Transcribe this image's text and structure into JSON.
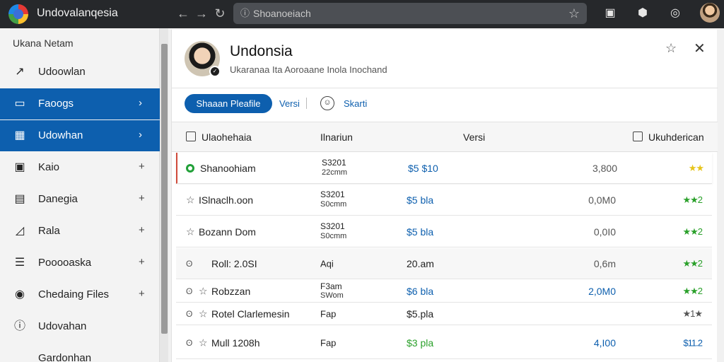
{
  "app": {
    "title": "Undovalanqesia"
  },
  "browser": {
    "back_icon": "arrow-left-icon",
    "forward_icon": "arrow-right-icon",
    "reload_icon": "reload-icon",
    "address_text": "Shoanoeiach",
    "address_icon": "info-icon",
    "bookmark_icon": "star-outline-icon",
    "toolbar_icons": [
      "save-icon",
      "extension-icon",
      "account-circle-icon"
    ]
  },
  "sidebar": {
    "header": "Ukana Netam",
    "items": [
      {
        "label": "Udoowlan",
        "icon": "edit-icon",
        "glyph": "↗",
        "active": false,
        "chevron": ""
      },
      {
        "label": "Faoogs",
        "icon": "folder-icon",
        "glyph": "▭",
        "active": true,
        "chevron": "›"
      },
      {
        "label": "Udowhan",
        "icon": "building-icon",
        "glyph": "▦",
        "active": true,
        "chevron": "›"
      },
      {
        "label": "Kaio",
        "icon": "calendar-icon",
        "glyph": "▣",
        "active": false,
        "chevron": "+"
      },
      {
        "label": "Danegia",
        "icon": "document-icon",
        "glyph": "▤",
        "active": false,
        "chevron": "+"
      },
      {
        "label": "Rala",
        "icon": "chart-icon",
        "glyph": "◿",
        "active": false,
        "chevron": "+"
      },
      {
        "label": "Pooooaska",
        "icon": "list-icon",
        "glyph": "☰",
        "active": false,
        "chevron": "+"
      },
      {
        "label": "Chedaing Files",
        "icon": "record-icon",
        "glyph": "◉",
        "active": false,
        "chevron": "+"
      },
      {
        "label": "Udovahan",
        "icon": "clock-icon",
        "glyph": "ⓘ",
        "active": false,
        "chevron": ""
      },
      {
        "label": "Gardonhan",
        "icon": "",
        "glyph": "",
        "active": false,
        "chevron": ""
      }
    ]
  },
  "main": {
    "title": "Undonsia",
    "subtitle": "Ukaranaa Ita Aoroaane Inola Inochand",
    "primary_button": "Shaaan Pleafile",
    "link_versi": "Versi",
    "link_skarti": "Skarti",
    "table": {
      "columns": [
        "Ulaohehaia",
        "Ilnariun",
        "Versi",
        "Ukuhderican"
      ],
      "rows": [
        {
          "lead": "",
          "mark": "dot",
          "name": "Shanoohiam",
          "a1": "S3201",
          "a2": "22cmm",
          "price": "$5 $10",
          "price_color": "#0d5fae",
          "version": "3,800",
          "version_color": "#555",
          "rating": "★★",
          "rating_color": "#e6c41a",
          "selected": true,
          "alt": false
        },
        {
          "lead": "",
          "mark": "star",
          "name": "ISlnaclh.oon",
          "a1": "S3201",
          "a2": "S0cmm",
          "price": "$5 bla",
          "price_color": "#0d5fae",
          "version": "0,0M0",
          "version_color": "#555",
          "rating": "★★2",
          "rating_color": "#2aa02a",
          "selected": false,
          "alt": false
        },
        {
          "lead": "",
          "mark": "star",
          "name": "Bozann Dom",
          "a1": "S3201",
          "a2": "S0cmm",
          "price": "$5 bla",
          "price_color": "#0d5fae",
          "version": "0,0I0",
          "version_color": "#555",
          "rating": "★★2",
          "rating_color": "#2aa02a",
          "selected": false,
          "alt": false
        },
        {
          "lead": "ʘ",
          "mark": "",
          "name": "Roll: 2.0SI",
          "a1": "",
          "a2": "",
          "single": "Aqi",
          "price": "20.am",
          "price_color": "#222",
          "version": "0,6m",
          "version_color": "#555",
          "rating": "★★2",
          "rating_color": "#2aa02a",
          "selected": false,
          "alt": true
        },
        {
          "lead": "ʘ",
          "mark": "star",
          "name": "Robzzan",
          "a1": "F3am",
          "a2": "SWom",
          "price": "$6 bla",
          "price_color": "#0d5fae",
          "version": "2,0M0",
          "version_color": "#0d5fae",
          "rating": "★★2",
          "rating_color": "#2aa02a",
          "selected": false,
          "alt": false
        },
        {
          "lead": "ʘ",
          "mark": "star",
          "name": "Rotel Clarlemesin",
          "a1": "",
          "a2": "",
          "single": "Fap",
          "price": "$5.pla",
          "price_color": "#222",
          "version": "",
          "version_color": "#555",
          "rating": "★1★",
          "rating_color": "#555",
          "selected": false,
          "alt": false
        },
        {
          "lead": "ʘ",
          "mark": "star",
          "name": "Mull 1208h",
          "a1": "",
          "a2": "",
          "single": "Fap",
          "price": "$3 pla",
          "price_color": "#2aa02a",
          "version": "4,I00",
          "version_color": "#0d5fae",
          "rating": "$11.2",
          "rating_color": "#0d5fae",
          "selected": false,
          "alt": false
        }
      ]
    }
  }
}
